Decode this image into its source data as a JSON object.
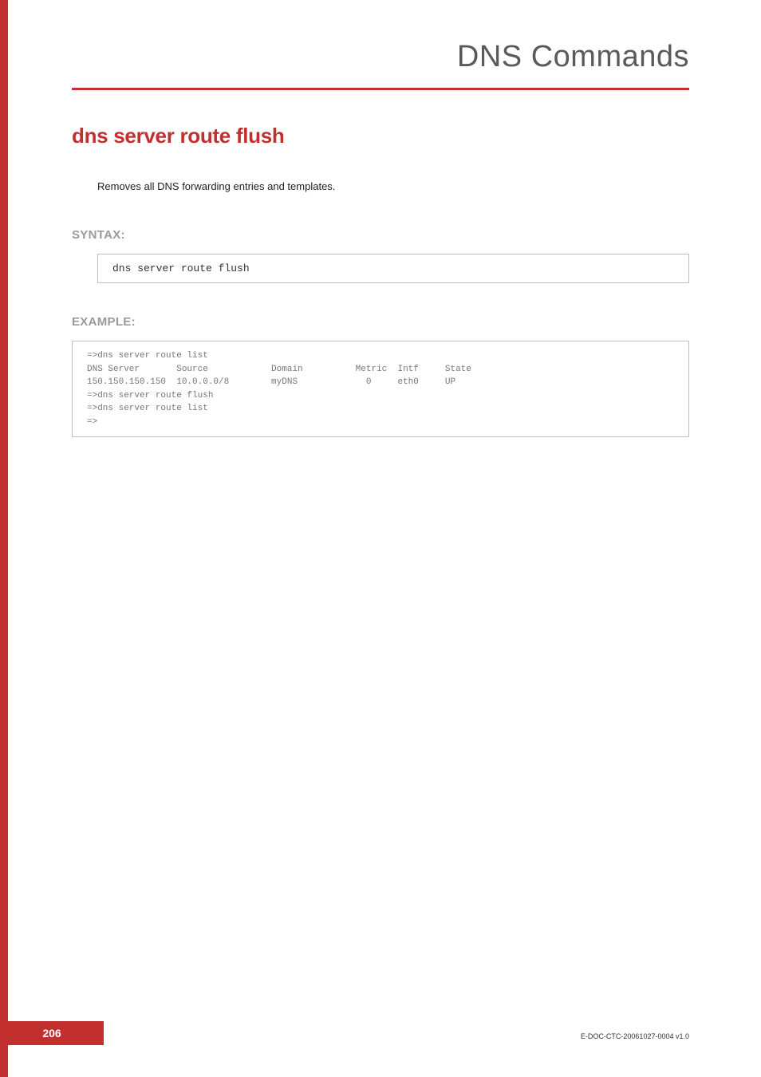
{
  "header": {
    "category_title": "DNS Commands"
  },
  "command": {
    "title": "dns server route flush",
    "description": "Removes all DNS forwarding entries and templates."
  },
  "syntax": {
    "label": "SYNTAX:",
    "code": "dns server route flush"
  },
  "example": {
    "label": "EXAMPLE:",
    "text": "=>dns server route list\nDNS Server       Source            Domain          Metric  Intf     State\n150.150.150.150  10.0.0.0/8        myDNS             0     eth0     UP\n=>dns server route flush\n=>dns server route list\n=>"
  },
  "footer": {
    "page_number": "206",
    "doc_id": "E-DOC-CTC-20061027-0004 v1.0"
  }
}
